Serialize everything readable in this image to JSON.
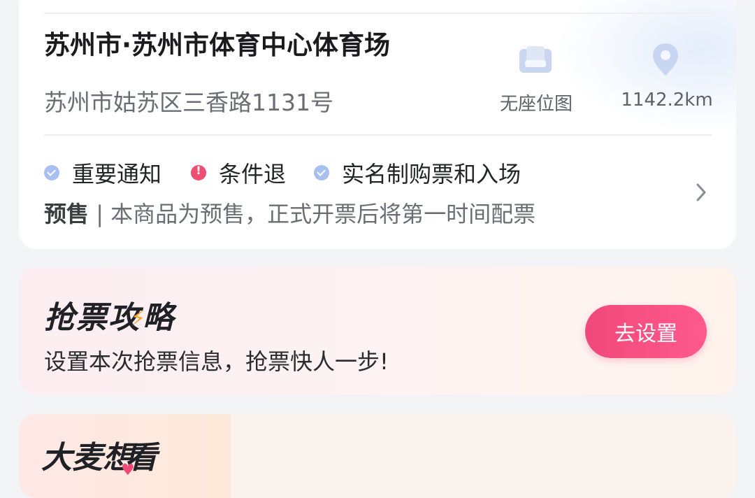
{
  "venue": {
    "name": "苏州市·苏州市体育中心体育场",
    "address": "苏州市姑苏区三香路1131号",
    "seat_map_label": "无座位图",
    "distance": "1142.2km",
    "seat_icon": "seat-map-icon",
    "pin_icon": "location-pin-icon"
  },
  "notices": {
    "tags": [
      {
        "label": "重要通知",
        "icon": "check-badge-icon",
        "color": "#a8bff2"
      },
      {
        "label": "条件退",
        "icon": "warning-icon",
        "color": "#ef4e72"
      },
      {
        "label": "实名制购票和入场",
        "icon": "check-badge-icon",
        "color": "#a8bff2"
      }
    ],
    "presale_label": "预售",
    "presale_text": " | 本商品为预售，正式开票后将第一时间配票"
  },
  "strategy": {
    "title_a": "抢票",
    "title_b": "攻",
    "title_c": "略",
    "subtitle": "设置本次抢票信息，抢票快人一步!",
    "button_label": "去设置",
    "button_color": "#f0487a"
  },
  "want": {
    "title_a": "大麦",
    "title_b": "想",
    "title_c": "看"
  }
}
